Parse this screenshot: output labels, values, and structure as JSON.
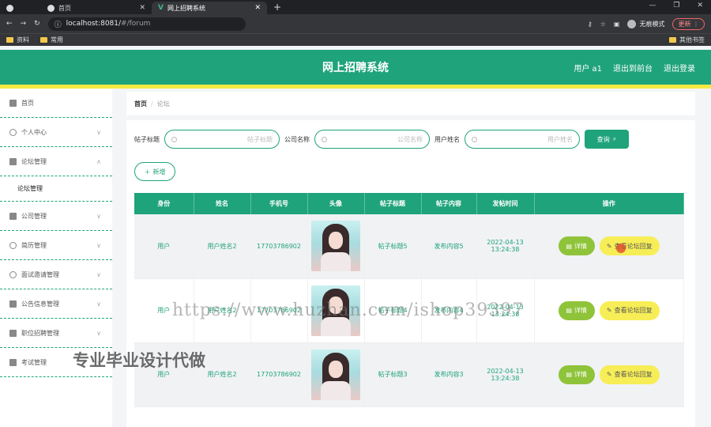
{
  "browser": {
    "tabs": [
      {
        "label": "",
        "icon": "globe-icon"
      },
      {
        "label": "首页",
        "icon": "globe-icon"
      },
      {
        "label": "网上招聘系统",
        "icon": "vue-logo-icon"
      }
    ],
    "url_host": "localhost:8081/",
    "url_path": "#/forum",
    "incognito": "无痕模式",
    "update": "更新",
    "bookmarks": [
      "资料",
      "常用"
    ],
    "other_bookmarks": "其他书签"
  },
  "app": {
    "title": "网上招聘系统",
    "user": "用户 a1",
    "back_front": "退出到前台",
    "logout": "退出登录",
    "accent": "#1fa37a",
    "strip": "#f5e942"
  },
  "sidebar": {
    "items": [
      {
        "label": "首页",
        "icon": "home-icon"
      },
      {
        "label": "个人中心",
        "icon": "user-icon"
      },
      {
        "label": "论坛管理",
        "icon": "briefcase-icon"
      },
      {
        "label": "论坛管理",
        "sub": true
      },
      {
        "label": "公司管理",
        "icon": "list-icon"
      },
      {
        "label": "简历管理",
        "icon": "power-icon"
      },
      {
        "label": "面试邀请管理",
        "icon": "clock-icon"
      },
      {
        "label": "公告信息管理",
        "icon": "mail-icon"
      },
      {
        "label": "职位招聘管理",
        "icon": "printer-icon"
      },
      {
        "label": "考试管理",
        "icon": "clipboard-icon"
      }
    ]
  },
  "breadcrumb": {
    "home": "首页",
    "sep": "/",
    "current": "论坛"
  },
  "search": {
    "title_label": "帖子标题",
    "title_placeholder": "帖子标题",
    "company_label": "公司名称",
    "company_placeholder": "公司名称",
    "username_label": "用户姓名",
    "username_placeholder": "用户姓名",
    "query": "查询",
    "add": "新增"
  },
  "table": {
    "headers": [
      "身份",
      "姓名",
      "手机号",
      "头像",
      "帖子标题",
      "帖子内容",
      "发帖时间",
      "操作"
    ],
    "rows": [
      {
        "role": "用户",
        "name": "用户姓名2",
        "phone": "17703786902",
        "title": "帖子标题5",
        "content": "发布内容5",
        "time": "2022-04-13 13:24:38"
      },
      {
        "role": "用户",
        "name": "用户姓名2",
        "phone": "17703786902",
        "title": "帖子标题4",
        "content": "发布内容4",
        "time": "2022-04-13 13:24:38"
      },
      {
        "role": "用户",
        "name": "用户姓名2",
        "phone": "17703786902",
        "title": "帖子标题3",
        "content": "发布内容3",
        "time": "2022-04-13 13:24:38"
      }
    ],
    "detail": "详情",
    "reply": "查看论坛回复"
  },
  "watermark": {
    "url": "https://www.huzhan.com/ishop39397",
    "text": "专业毕业设计代做"
  }
}
